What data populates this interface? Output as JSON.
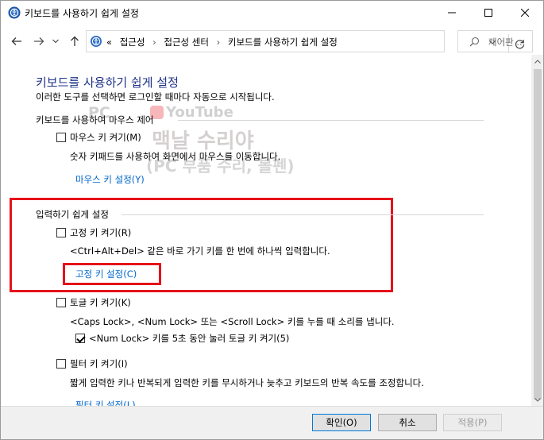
{
  "window": {
    "title": "키보드를 사용하기 쉽게 설정"
  },
  "address": {
    "chevrons": "«",
    "crumbs": [
      "접근성",
      "접근성 센터",
      "키보드를 사용하기 쉽게 설정"
    ],
    "search_placeholder": "제어판 ..."
  },
  "page": {
    "title": "키보드를 사용하기 쉽게 설정",
    "subtitle": "이러한 도구를 선택하면 로그인할 때마다 자동으로 시작됩니다."
  },
  "sections": {
    "mouse": {
      "heading": "키보드를 사용하여 마우스 제어",
      "mouse_keys_label": "마우스 키 켜기(M)",
      "mouse_keys_desc": "숫자 키패드를 사용하여 화면에서 마우스를 이동합니다.",
      "mouse_keys_link": "마우스 키 설정(Y)"
    },
    "typing": {
      "heading": "입력하기 쉽게 설정",
      "sticky_label": "고정 키 켜기(R)",
      "sticky_desc": "<Ctrl+Alt+Del> 같은 바로 가기 키를 한 번에 하나씩 입력합니다.",
      "sticky_link": "고정 키 설정(C)",
      "toggle_label": "토글 키 켜기(K)",
      "toggle_desc": "<Caps Lock>, <Num Lock> 또는 <Scroll Lock> 키를 누를 때 소리를 냅니다.",
      "toggle_sub_label": "<Num Lock> 키를 5초 동안 눌러 토글 키 켜기(5)",
      "filter_label": "필터 키 켜기(I)",
      "filter_desc": "짧게 입력한 키나 반복되게 입력한 키를 무시하거나 늦추고 키보드의 반복 속도를 조정합니다.",
      "filter_link": "필터 키 설정(L)"
    }
  },
  "watermark": {
    "line1": "PC",
    "line1b": "YouTube",
    "line2": "맥날 수리야",
    "line3": "(PC 부품 수리, 볼펜)"
  },
  "footer": {
    "ok": "확인(O)",
    "cancel": "취소",
    "apply": "적용(P)"
  },
  "colors": {
    "title_blue": "#1e3287",
    "link_blue": "#0066cc",
    "highlight_red": "#e5121a"
  }
}
